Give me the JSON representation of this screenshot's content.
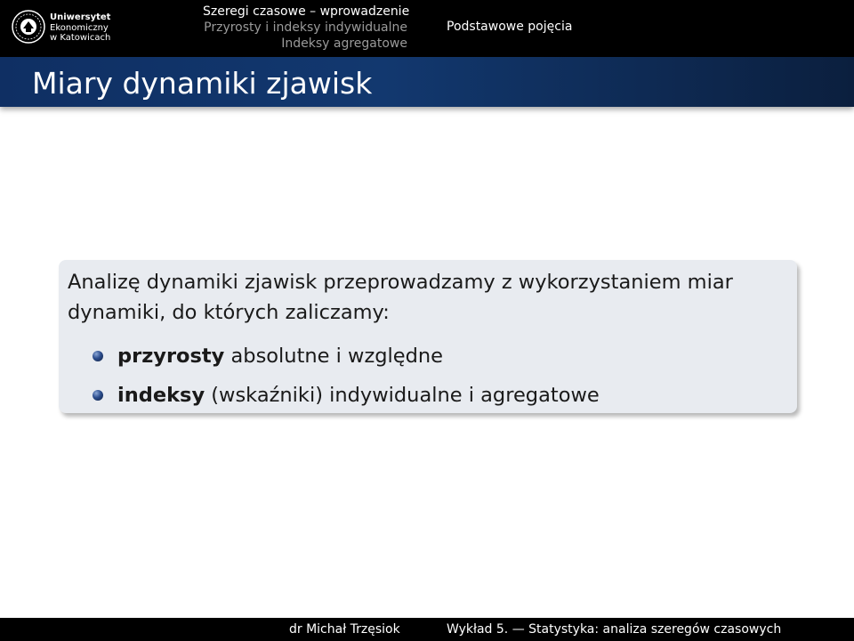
{
  "header": {
    "logo": {
      "line1": "Uniwersytet",
      "line2": "Ekonomiczny",
      "line3": "w Katowicach"
    },
    "sections": [
      {
        "label": "Szeregi czasowe – wprowadzenie",
        "active": true
      },
      {
        "label": "Przyrosty i indeksy indywidualne",
        "active": false
      },
      {
        "label": "Indeksy agregatowe",
        "active": false
      }
    ],
    "subsection": "Podstawowe pojęcia"
  },
  "frame": {
    "title": "Miary dynamiki zjawisk"
  },
  "block": {
    "intro": "Analizę dynamiki zjawisk przeprowadzamy z wykorzystaniem miar dynamiki, do których zaliczamy:",
    "items": [
      {
        "bold": "przyrosty",
        "rest": " absolutne i względne"
      },
      {
        "bold": "indeksy",
        "rest": " (wskaźniki) indywidualne i agregatowe"
      }
    ]
  },
  "footer": {
    "author": "dr Michał Trzęsiok",
    "lecture": "Wykład 5. — Statystyka: analiza szeregów czasowych"
  }
}
